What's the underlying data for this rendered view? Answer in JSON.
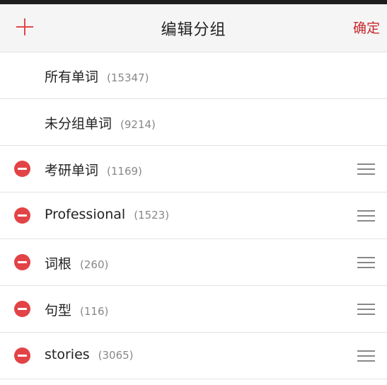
{
  "header": {
    "title": "编辑分组",
    "confirm_label": "确定",
    "add_icon": "plus-icon"
  },
  "colors": {
    "accent": "#e0484a",
    "confirm_text": "#c8282f",
    "remove_badge": "#e24346",
    "header_bg": "#f5f5f5"
  },
  "groups": [
    {
      "label": "所有单词",
      "count": "(15347)",
      "editable": false
    },
    {
      "label": "未分组单词",
      "count": "(9214)",
      "editable": false
    },
    {
      "label": "考研单词",
      "count": "(1169)",
      "editable": true
    },
    {
      "label": "Professional",
      "count": "(1523)",
      "editable": true
    },
    {
      "label": "词根",
      "count": "(260)",
      "editable": true
    },
    {
      "label": "句型",
      "count": "(116)",
      "editable": true
    },
    {
      "label": "stories",
      "count": "(3065)",
      "editable": true
    }
  ]
}
